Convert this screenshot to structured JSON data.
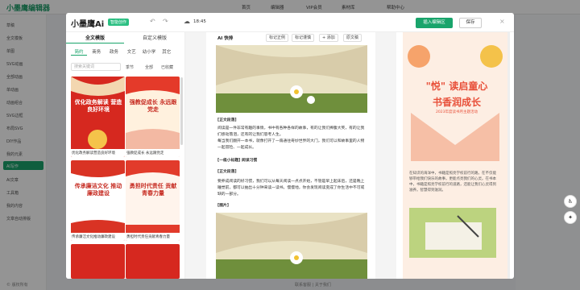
{
  "bg": {
    "logo": "小墨鹰编辑器",
    "nav": [
      "首页",
      "编辑器",
      "VIP会员",
      "素材库",
      "帮助中心"
    ],
    "sidebar": [
      "草稿",
      "全文模板",
      "单图",
      "SVG动画",
      "全部动画",
      "单动画",
      "动画组合",
      "SVG边框",
      "布局SVG",
      "DIY作品",
      "我的元素",
      "AI写作",
      "AI文章",
      "工具箱",
      "我的内容",
      "文章自动排版"
    ],
    "footer_left": "© 版权所有",
    "footer_mid": "联系客服 | 关于我们"
  },
  "modal": {
    "logo": "小墨鹰Ai",
    "badge": "智能创作",
    "undo_icon": "undo-icon",
    "redo_icon": "redo-icon",
    "save_time": "18:45",
    "insert_btn": "插入编辑区",
    "save_btn": "保存",
    "close": "×",
    "tabs": [
      "全文模版",
      "自定义模版"
    ],
    "categories": [
      "简约",
      "商务",
      "政务",
      "文艺",
      "幼小学",
      "其它"
    ],
    "search_placeholder": "搜索关键词",
    "filters": [
      "季节",
      "全部",
      "已收藏"
    ],
    "templates": [
      {
        "title": "优化政务解读 营造良好环境",
        "caption": "优化政务解读营造良好环境"
      },
      {
        "title": "强教促成长 永远跟党走",
        "caption": "强教促成长 永远跟党走"
      },
      {
        "title": "传承廉洁文化 推动廉政建设",
        "caption": "传承廉洁文化推动廉政建设"
      },
      {
        "title": "勇担时代责任 贡献青春力量",
        "caption": "勇担时代责任贡献青春力量"
      }
    ],
    "toolbar": {
      "ai": "AI 快排",
      "buttons": [
        "标记正例",
        "标记谨慎",
        "+ 添加",
        "原文稿"
      ]
    },
    "doc": [
      {
        "type": "label",
        "text": "[正文段落]"
      },
      {
        "type": "text",
        "text": "阅读是一件非常有趣的事情，书中有各种各样的故事，有的让我们捧腹大笑，有的让我们感动落泪，还有的让我们思考人生。"
      },
      {
        "type": "text",
        "text": "每当我们翻开一本书，就像打开了一扇通往奇妙世界的大门，我们可以和故事里的人物一起冒险、一起成长。"
      },
      {
        "type": "label",
        "text": "[一级小标题] 阅读习惯"
      },
      {
        "type": "label",
        "text": "[正文段落]"
      },
      {
        "type": "text",
        "text": "要养成阅读的好习惯，我们可以从每天阅读一点点开始，不管是早上起床后，还是晚上睡觉前，都可以抽出十分钟来读一读书。慢慢地，你会发现阅读变成了你生活中不可或缺的一部分。"
      },
      {
        "type": "label",
        "text": "[图片]"
      }
    ],
    "preview": {
      "title1": "\"悦\" 读启童心",
      "title2": "书香润成长",
      "subtitle": "2023年度读书月主题活动",
      "text": "在知识的海洋中，书籍是照亮学校前行的路。在不仅能够带给我们快乐的故事，更能点亮我们的心灵。在书本中，书籍是照亮学校前行的道路，还能让我们心灵得到滋养。智慧得到滋润。"
    }
  }
}
